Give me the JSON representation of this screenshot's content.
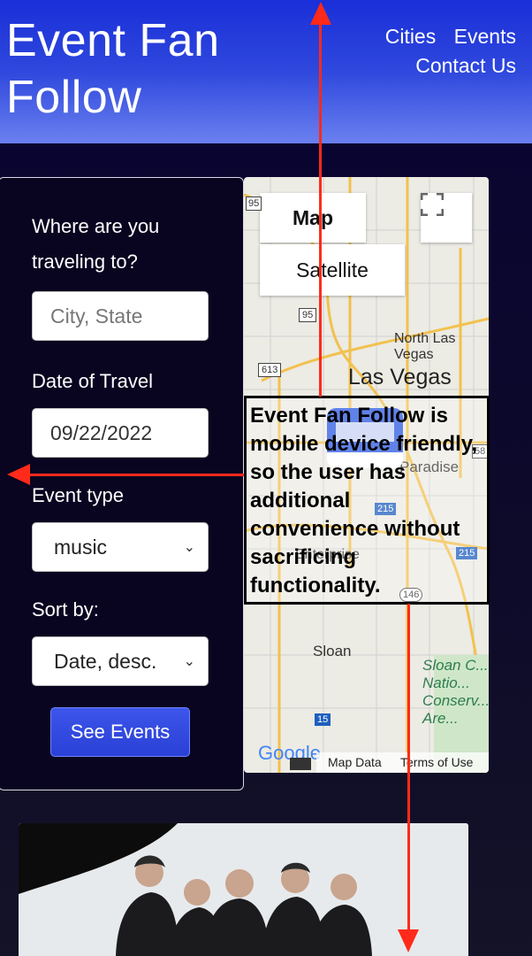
{
  "header": {
    "brand": "Event Fan Follow",
    "nav": [
      "Cities",
      "Events",
      "Contact Us"
    ]
  },
  "form": {
    "destination_label": "Where are you traveling to?",
    "destination_placeholder": "City, State",
    "date_label": "Date of Travel",
    "date_value": "09/22/2022",
    "event_type_label": "Event type",
    "event_type_value": "music",
    "sort_label": "Sort by:",
    "sort_value": "Date, desc.",
    "submit_label": "See Events"
  },
  "map": {
    "map_button": "Map",
    "satellite_button": "Satellite",
    "labels": {
      "north_las_vegas": "North Las Vegas",
      "las_vegas": "Las Vegas",
      "sloan": "Sloan",
      "sloan_canyon": "Sloan C... Natio... Conserv... Are...",
      "enterprise": "Enterprise",
      "paradise": "Paradise",
      "google": "Google"
    },
    "highway_shields": [
      "95",
      "95",
      "613",
      "215",
      "215",
      "146",
      "15",
      "58"
    ],
    "footer_map_data": "Map Data",
    "footer_terms": "Terms of Use"
  },
  "annotation": {
    "text": "Event Fan Follow is mobile device friendly, so the user has additional convenience without sacrificing functionality."
  },
  "colors": {
    "header_top": "#1a2fd8",
    "header_bottom": "#6a80ef",
    "background": "#0b0726",
    "button": "#2f48dd",
    "arrow": "#ff2a1a"
  }
}
